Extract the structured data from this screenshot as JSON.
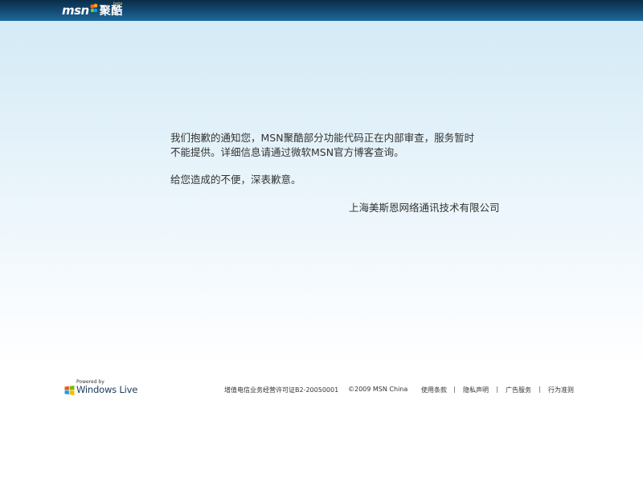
{
  "header": {
    "logo_text": "msn",
    "logo_zh": "聚酷",
    "logo_beta": "beta"
  },
  "message": {
    "line1": "我们抱歉的通知您，MSN聚酷部分功能代码正在内部审查，服务暂时",
    "line2": "不能提供。详细信息请通过微软MSN官方博客查询。",
    "line3": "给您造成的不便，深表歉意。",
    "company": "上海美斯恩网络通讯技术有限公司"
  },
  "footer": {
    "powered_by": "Powered by",
    "windows_live": "Windows Live",
    "license": "增值电信业务经营许可证B2-20050001",
    "copyright": "©2009 MSN China",
    "links": [
      "使用条款",
      "隐私声明",
      "广告服务",
      "行为准则"
    ],
    "separator": "|"
  },
  "colors": {
    "header_bg": "#12476e",
    "content_top": "#d4eaf6",
    "text": "#333333"
  }
}
